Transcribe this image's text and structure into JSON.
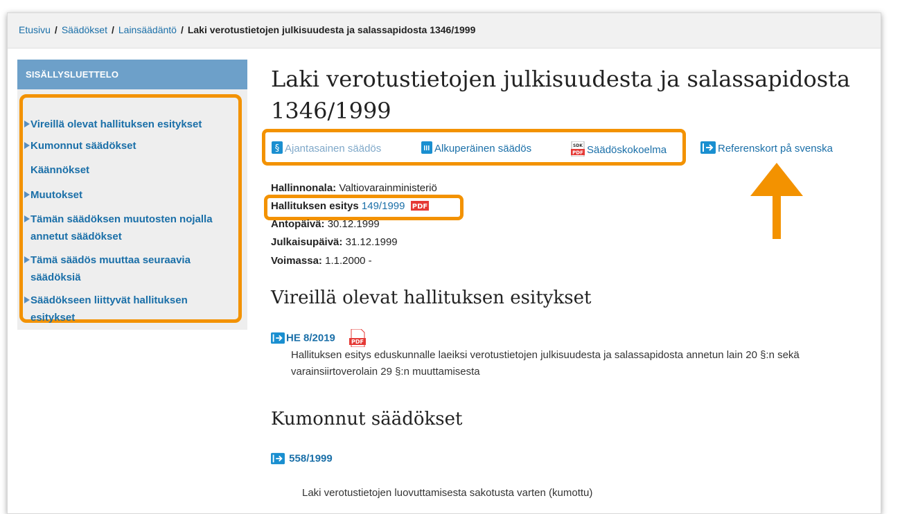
{
  "breadcrumb": {
    "items": [
      "Etusivu",
      "Säädökset",
      "Lainsäädäntö"
    ],
    "separator": "/",
    "current": "Laki verotustietojen julkisuudesta ja salassapidosta 1346/1999"
  },
  "toc": {
    "header": "SISÄLLYSLUETTELO",
    "items": [
      {
        "label": "Vireillä olevat hallituksen esitykset",
        "arrow": true
      },
      {
        "label": "Kumonnut säädökset",
        "arrow": true
      },
      {
        "label": "Käännökset",
        "arrow": false
      },
      {
        "label": "Muutokset",
        "arrow": true
      },
      {
        "label": "Tämän säädöksen muutosten nojalla",
        "label2": "annetut säädökset",
        "arrow": true
      },
      {
        "label": "Tämä säädös muuttaa seuraavia",
        "label2": "säädöksiä",
        "arrow": true
      },
      {
        "label": "Säädökseen liittyvät hallituksen",
        "label2": "esitykset",
        "arrow": true
      }
    ]
  },
  "title": {
    "line1": "Laki verotustietojen julkisuudesta ja salassapidosta",
    "line2": "1346/1999"
  },
  "actions": {
    "current": "Ajantasainen säädös",
    "original": "Alkuperäinen säädös",
    "collection": "Säädöskokoelma",
    "swedish": "Referenskort på svenska",
    "collection_icon_text": "SDK",
    "pdf_text": "PDF",
    "section_symbol": "§"
  },
  "meta": {
    "ministry_label": "Hallinnonala:",
    "ministry_value": "Valtiovarainministeriö",
    "gov_label": "Hallituksen esitys",
    "gov_value": "149/1999",
    "date_label": "Antopäivä:",
    "date_value": "30.12.1999",
    "pub_label": "Julkaisupäivä:",
    "pub_value": "31.12.1999",
    "valid_label": "Voimassa:",
    "valid_value": "1.1.2000 -"
  },
  "pending": {
    "heading": "Vireillä olevat hallituksen esitykset",
    "link": "HE 8/2019",
    "line1": "Hallituksen esitys eduskunnalle laeiksi verotustietojen julkisuudesta ja salassapidosta annetun lain 20 §:n sekä",
    "line2": "varainsiirtoverolain 29 §:n muuttamisesta"
  },
  "repealed": {
    "heading": "Kumonnut säädökset",
    "link": "558/1999",
    "desc": "Laki verotustietojen luovuttamisesta sakotusta varten (kumottu)"
  },
  "colors": {
    "highlight": "#f39200",
    "link": "#1a6fa8",
    "toc_header": "#6da0c9",
    "pdf_red": "#e53935"
  }
}
